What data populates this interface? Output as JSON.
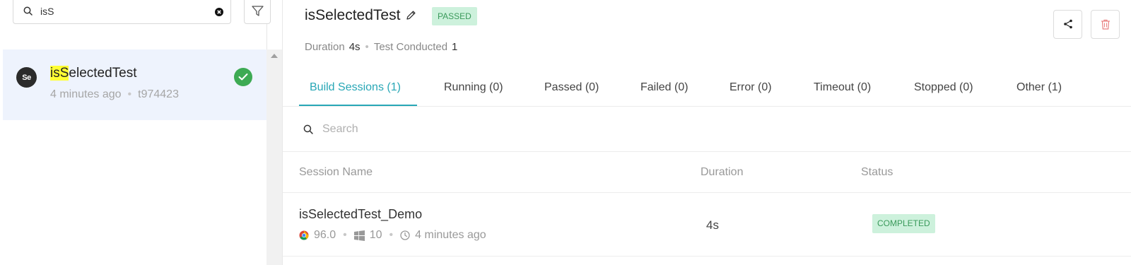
{
  "sidebar": {
    "search": {
      "value": "isS"
    },
    "test_item": {
      "name_highlight": "isS",
      "name_rest": "electedTest",
      "avatar_label": "Se",
      "time": "4 minutes ago",
      "id": "t974423"
    }
  },
  "header": {
    "title": "isSelectedTest",
    "status": "PASSED",
    "duration_label": "Duration",
    "duration_value": "4s",
    "conducted_label": "Test Conducted",
    "conducted_value": "1"
  },
  "tabs": [
    {
      "label": "Build Sessions (1)",
      "active": true
    },
    {
      "label": "Running (0)"
    },
    {
      "label": "Passed (0)"
    },
    {
      "label": "Failed (0)"
    },
    {
      "label": "Error (0)"
    },
    {
      "label": "Timeout (0)"
    },
    {
      "label": "Stopped (0)"
    },
    {
      "label": "Other (1)"
    }
  ],
  "table": {
    "search_placeholder": "Search",
    "columns": [
      "Session Name",
      "Duration",
      "Status"
    ],
    "rows": [
      {
        "name": "isSelectedTest_Demo",
        "browser_version": "96.0",
        "os_version": "10",
        "time": "4 minutes ago",
        "duration": "4s",
        "status": "COMPLETED"
      }
    ]
  },
  "colors": {
    "accent": "#28a7b6",
    "success": "#3daa53",
    "badge_bg": "#cdf1dc",
    "badge_text": "#3b9a5b",
    "highlight": "#ffff33",
    "selected_bg": "#eef3fd",
    "danger": "#e88080"
  },
  "icons": [
    "search-icon",
    "clear-icon",
    "filter-icon",
    "check-icon",
    "edit-icon",
    "share-icon",
    "trash-icon",
    "chrome-icon",
    "windows-icon",
    "clock-icon"
  ]
}
